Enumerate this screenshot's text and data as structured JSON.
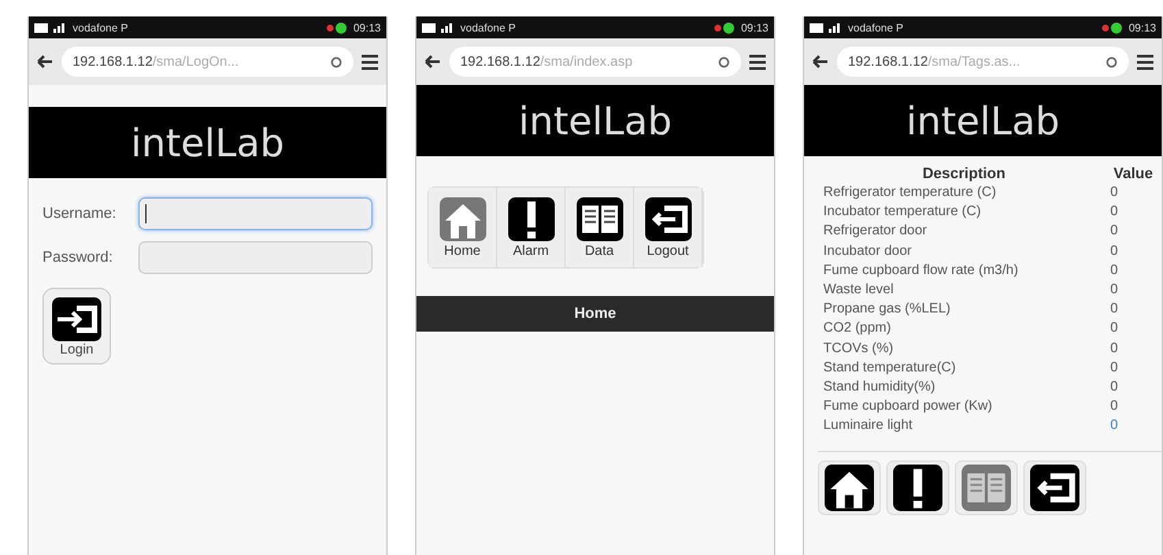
{
  "phones": [
    {
      "kind": "login",
      "status": {
        "carrier": "vodafone P",
        "time": "09:13"
      },
      "url": {
        "host": "192.168.1.12",
        "path": "/sma/LogOn..."
      },
      "title": "intelLab",
      "login": {
        "fields": [
          {
            "label": "Username:",
            "focused": true
          },
          {
            "label": "Password:",
            "focused": false
          }
        ],
        "button": "Login"
      }
    },
    {
      "kind": "menu",
      "status": {
        "carrier": "vodafone P",
        "time": "09:13"
      },
      "url": {
        "host": "192.168.1.12",
        "path": "/sma/index.asp"
      },
      "title": "intelLab",
      "nav": [
        {
          "kind": "home",
          "label": "Home",
          "selected": true
        },
        {
          "kind": "alarm",
          "label": "Alarm",
          "selected": false
        },
        {
          "kind": "data",
          "label": "Data",
          "selected": false
        },
        {
          "kind": "logout",
          "label": "Logout",
          "selected": false
        }
      ],
      "section": "Home"
    },
    {
      "kind": "tags",
      "status": {
        "carrier": "vodafone P",
        "time": "09:13"
      },
      "url": {
        "host": "192.168.1.12",
        "path": "/sma/Tags.as..."
      },
      "title": "intelLab",
      "table": {
        "columns": [
          "Description",
          "Value"
        ],
        "rows": [
          {
            "description": "Refrigerator temperature (C)",
            "value": "0",
            "link": false
          },
          {
            "description": "Incubator temperature (C)",
            "value": "0",
            "link": false
          },
          {
            "description": "Refrigerator door",
            "value": "0",
            "link": false
          },
          {
            "description": "Incubator door",
            "value": "0",
            "link": false
          },
          {
            "description": "Fume cupboard flow rate (m3/h)",
            "value": "0",
            "link": false
          },
          {
            "description": "Waste level",
            "value": "0",
            "link": false
          },
          {
            "description": "Propane gas (%LEL)",
            "value": "0",
            "link": false
          },
          {
            "description": "CO2 (ppm)",
            "value": "0",
            "link": false
          },
          {
            "description": "TCOVs (%)",
            "value": "0",
            "link": false
          },
          {
            "description": "Stand temperature(C)",
            "value": "0",
            "link": false
          },
          {
            "description": "Stand humidity(%)",
            "value": "0",
            "link": false
          },
          {
            "description": "Fume cupboard power (Kw)",
            "value": "0",
            "link": false
          },
          {
            "description": "Luminaire light",
            "value": "0",
            "link": true
          }
        ]
      },
      "nav": [
        {
          "kind": "home",
          "selected": false
        },
        {
          "kind": "alarm",
          "selected": false
        },
        {
          "kind": "data",
          "selected": true
        },
        {
          "kind": "logout",
          "selected": false
        }
      ]
    }
  ]
}
